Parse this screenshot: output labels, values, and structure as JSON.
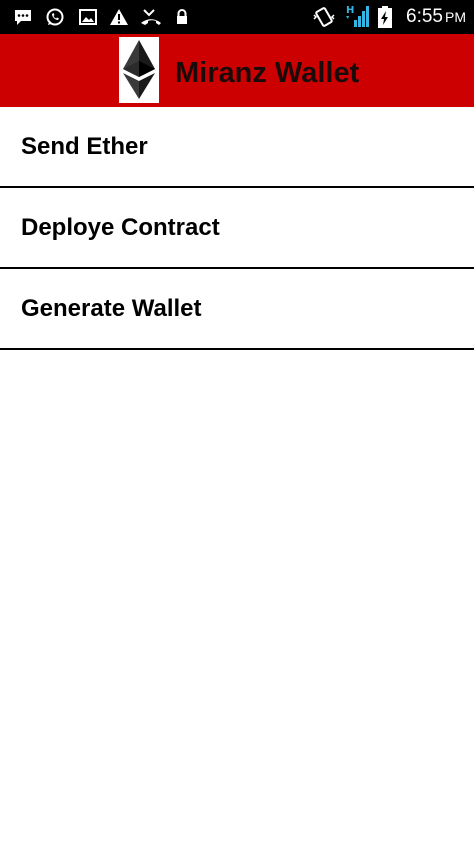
{
  "status_bar": {
    "time": "6:55",
    "ampm": "PM",
    "network_label": "H",
    "icons": [
      "message-icon",
      "whatsapp-icon",
      "image-icon",
      "warning-icon",
      "missed-call-icon",
      "lock-icon",
      "vibrate-icon",
      "signal-icon",
      "battery-charging-icon"
    ]
  },
  "app_bar": {
    "title": "Miranz Wallet",
    "logo": "ethereum-logo",
    "background_color": "#cc0000"
  },
  "menu": {
    "items": [
      {
        "label": "Send Ether"
      },
      {
        "label": "Deploye Contract"
      },
      {
        "label": "Generate Wallet"
      }
    ]
  }
}
